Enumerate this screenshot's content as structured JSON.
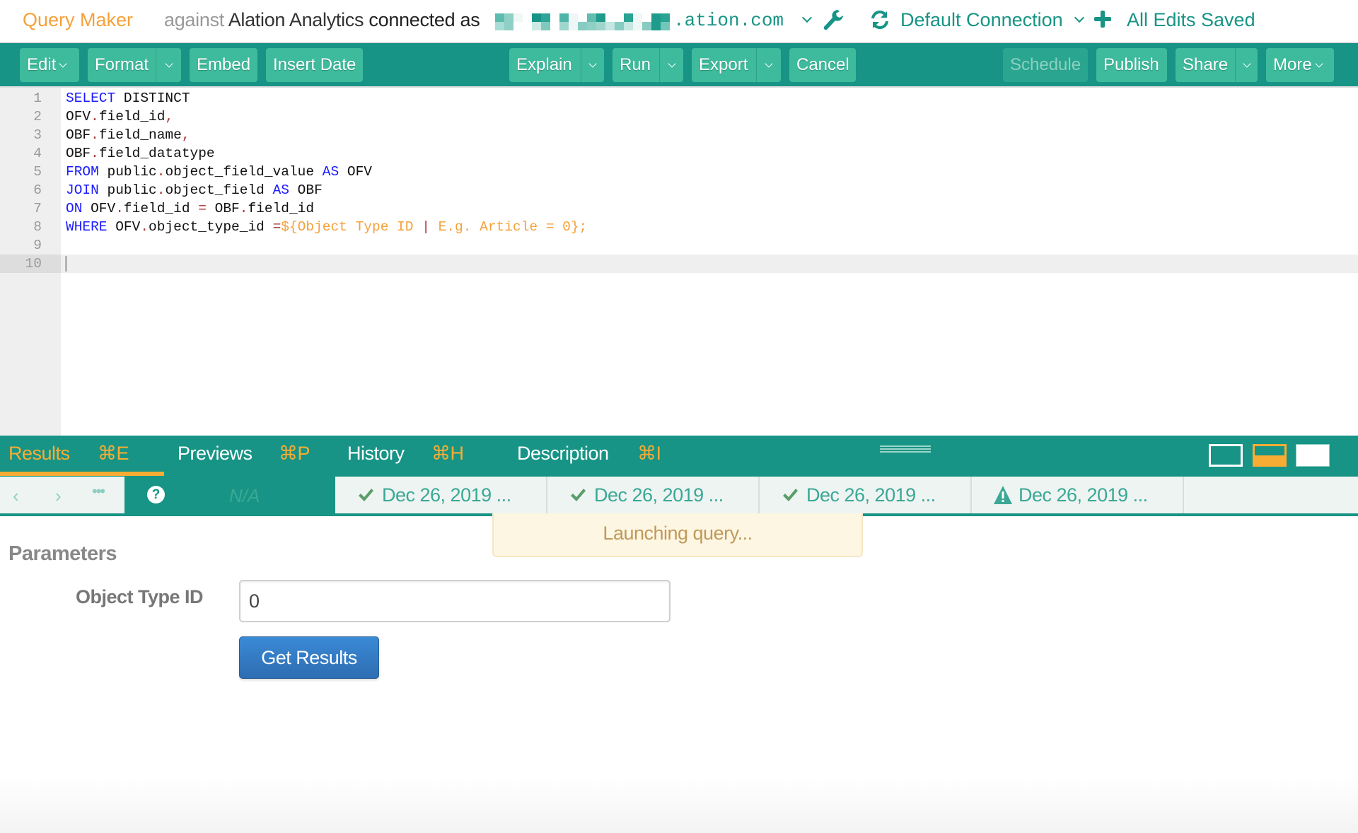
{
  "header": {
    "title": "Query Maker",
    "against_label": "against",
    "datasource": "Alation Analytics",
    "connected_label": "connected as",
    "email_visible_suffix": ".ation.com",
    "connection_name": "Default Connection",
    "save_status": "All Edits Saved"
  },
  "toolbar": {
    "left": [
      {
        "id": "edit",
        "label": "Edit",
        "dropdown": "inline"
      },
      {
        "id": "format",
        "label": "Format",
        "dropdown": "split"
      },
      {
        "id": "embed",
        "label": "Embed"
      },
      {
        "id": "insert-date",
        "label": "Insert Date"
      }
    ],
    "center": [
      {
        "id": "explain",
        "label": "Explain",
        "dropdown": "split"
      },
      {
        "id": "run",
        "label": "Run",
        "dropdown": "split"
      },
      {
        "id": "export",
        "label": "Export",
        "dropdown": "split"
      },
      {
        "id": "cancel",
        "label": "Cancel"
      }
    ],
    "right": [
      {
        "id": "schedule",
        "label": "Schedule",
        "disabled": true
      },
      {
        "id": "publish",
        "label": "Publish"
      },
      {
        "id": "share",
        "label": "Share",
        "dropdown": "split"
      },
      {
        "id": "more",
        "label": "More",
        "dropdown": "inline"
      }
    ]
  },
  "editor": {
    "active_line": 10,
    "lines": [
      {
        "n": "1",
        "tokens": [
          [
            "kw",
            "SELECT"
          ],
          [
            "t",
            " DISTINCT"
          ]
        ]
      },
      {
        "n": "2",
        "tokens": [
          [
            "t",
            "OFV"
          ],
          [
            "op",
            "."
          ],
          [
            "t",
            "field_id"
          ],
          [
            "op",
            ","
          ]
        ]
      },
      {
        "n": "3",
        "tokens": [
          [
            "t",
            "OBF"
          ],
          [
            "op",
            "."
          ],
          [
            "t",
            "field_name"
          ],
          [
            "op",
            ","
          ]
        ]
      },
      {
        "n": "4",
        "tokens": [
          [
            "t",
            "OBF"
          ],
          [
            "op",
            "."
          ],
          [
            "t",
            "field_datatype"
          ]
        ]
      },
      {
        "n": "5",
        "tokens": [
          [
            "kw",
            "FROM"
          ],
          [
            "t",
            " public"
          ],
          [
            "op",
            "."
          ],
          [
            "t",
            "object_field_value "
          ],
          [
            "kw",
            "AS"
          ],
          [
            "t",
            " OFV"
          ]
        ]
      },
      {
        "n": "6",
        "tokens": [
          [
            "kw",
            "JOIN"
          ],
          [
            "t",
            " public"
          ],
          [
            "op",
            "."
          ],
          [
            "t",
            "object_field "
          ],
          [
            "kw",
            "AS"
          ],
          [
            "t",
            " OBF"
          ]
        ]
      },
      {
        "n": "7",
        "tokens": [
          [
            "kw",
            "ON"
          ],
          [
            "t",
            " OFV"
          ],
          [
            "op",
            "."
          ],
          [
            "t",
            "field_id "
          ],
          [
            "op",
            "="
          ],
          [
            "t",
            " OBF"
          ],
          [
            "op",
            "."
          ],
          [
            "t",
            "field_id"
          ]
        ]
      },
      {
        "n": "8",
        "tokens": [
          [
            "kw",
            "WHERE"
          ],
          [
            "t",
            " OFV"
          ],
          [
            "op",
            "."
          ],
          [
            "t",
            "object_type_id "
          ],
          [
            "op",
            "="
          ],
          [
            "param",
            "${Object Type ID "
          ],
          [
            "op",
            "|"
          ],
          [
            "param",
            " E.g. Article = 0};"
          ]
        ]
      },
      {
        "n": "9",
        "tokens": []
      },
      {
        "n": "10",
        "tokens": []
      }
    ]
  },
  "results_tabs": [
    {
      "label": "Results",
      "shortcut": "⌘E",
      "active": true
    },
    {
      "label": "Previews",
      "shortcut": "⌘P"
    },
    {
      "label": "History",
      "shortcut": "⌘H"
    },
    {
      "label": "Description",
      "shortcut": "⌘I"
    }
  ],
  "history": {
    "prev_label": "‹",
    "next_label": "›",
    "more_label": "•••",
    "current": {
      "status": "unknown",
      "icon": "?",
      "label": "N/A"
    },
    "runs": [
      {
        "status": "success",
        "label": "Dec 26, 2019 ..."
      },
      {
        "status": "success",
        "label": "Dec 26, 2019 ..."
      },
      {
        "status": "success",
        "label": "Dec 26, 2019 ..."
      },
      {
        "status": "warning",
        "label": "Dec 26, 2019 ..."
      }
    ]
  },
  "toast": {
    "message": "Launching query..."
  },
  "parameters": {
    "title": "Parameters",
    "fields": [
      {
        "label": "Object Type ID",
        "value": "0"
      }
    ],
    "submit_label": "Get Results"
  },
  "colors": {
    "teal": "#179485",
    "button": "#3dbb9c",
    "orange": "#f9ac34",
    "keyword_blue": "#1a1aff",
    "success_green": "#5a9e6a",
    "primary_blue": "#2e6db2"
  }
}
